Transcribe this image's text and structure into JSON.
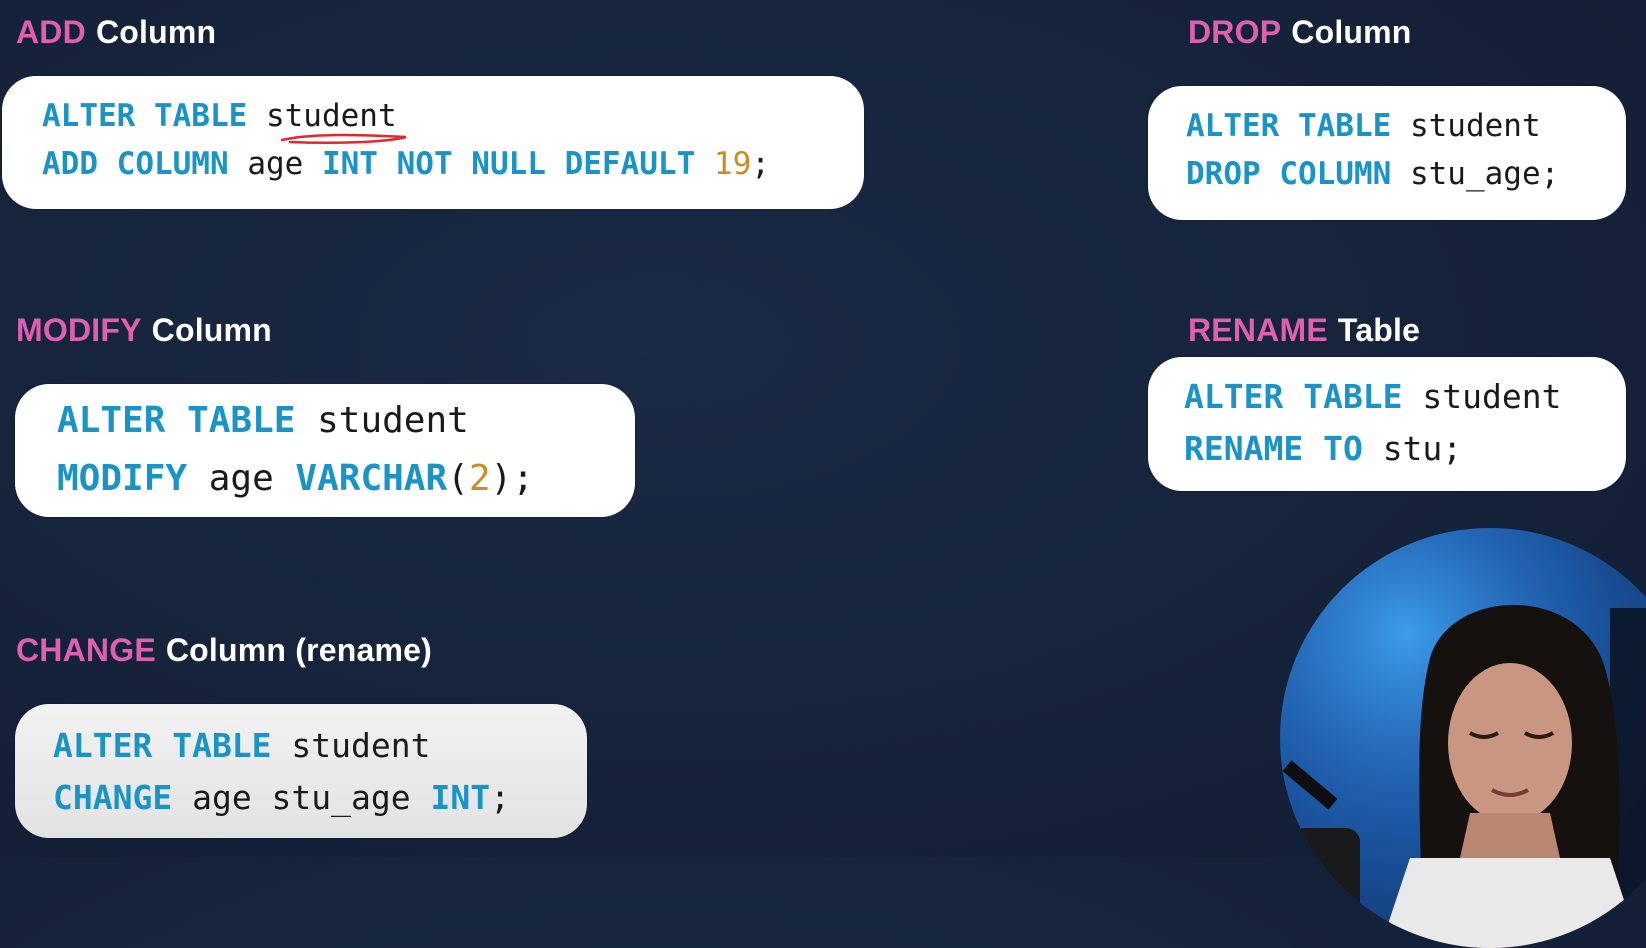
{
  "sections": {
    "add": {
      "keyword": "ADD",
      "rest": "Column",
      "line1": [
        {
          "text": "ALTER TABLE ",
          "style": "k"
        },
        {
          "text": "student",
          "style": "t"
        }
      ],
      "line2": [
        {
          "text": "ADD COLUMN ",
          "style": "k"
        },
        {
          "text": "age ",
          "style": "t"
        },
        {
          "text": "INT NOT NULL DEFAULT ",
          "style": "k"
        },
        {
          "text": "19",
          "style": "n"
        },
        {
          "text": ";",
          "style": "t"
        }
      ]
    },
    "drop": {
      "keyword": "DROP",
      "rest": "Column",
      "line1": [
        {
          "text": "ALTER TABLE ",
          "style": "k"
        },
        {
          "text": "student",
          "style": "t"
        }
      ],
      "line2": [
        {
          "text": "DROP COLUMN ",
          "style": "k"
        },
        {
          "text": "stu_age;",
          "style": "t"
        }
      ]
    },
    "modify": {
      "keyword": "MODIFY",
      "rest": "Column",
      "line1": [
        {
          "text": "ALTER TABLE ",
          "style": "k"
        },
        {
          "text": "student",
          "style": "t"
        }
      ],
      "line2": [
        {
          "text": "MODIFY ",
          "style": "k"
        },
        {
          "text": "age ",
          "style": "t"
        },
        {
          "text": "VARCHAR",
          "style": "k"
        },
        {
          "text": "(",
          "style": "t"
        },
        {
          "text": "2",
          "style": "n"
        },
        {
          "text": ");",
          "style": "t"
        }
      ]
    },
    "rename": {
      "keyword": "RENAME",
      "rest": "Table",
      "line1": [
        {
          "text": "ALTER TABLE ",
          "style": "k"
        },
        {
          "text": "student",
          "style": "t"
        }
      ],
      "line2": [
        {
          "text": "RENAME TO ",
          "style": "k"
        },
        {
          "text": "stu;",
          "style": "t"
        }
      ]
    },
    "change": {
      "keyword": "CHANGE",
      "rest": "Column (rename)",
      "line1": [
        {
          "text": "ALTER TABLE ",
          "style": "k"
        },
        {
          "text": "student",
          "style": "t"
        }
      ],
      "line2": [
        {
          "text": "CHANGE ",
          "style": "k"
        },
        {
          "text": "age stu_age ",
          "style": "t"
        },
        {
          "text": "INT",
          "style": "k"
        },
        {
          "text": ";",
          "style": "t"
        }
      ]
    }
  },
  "colors": {
    "background": "#15233b",
    "title_keyword": "#e05fb0",
    "title_text": "#ffffff",
    "sql_keyword": "#1a93c6",
    "sql_number": "#c98d22",
    "sql_text": "#1a1a1a",
    "annotation": "#e0282e"
  },
  "icons": {
    "webcam": "presenter-webcam"
  }
}
